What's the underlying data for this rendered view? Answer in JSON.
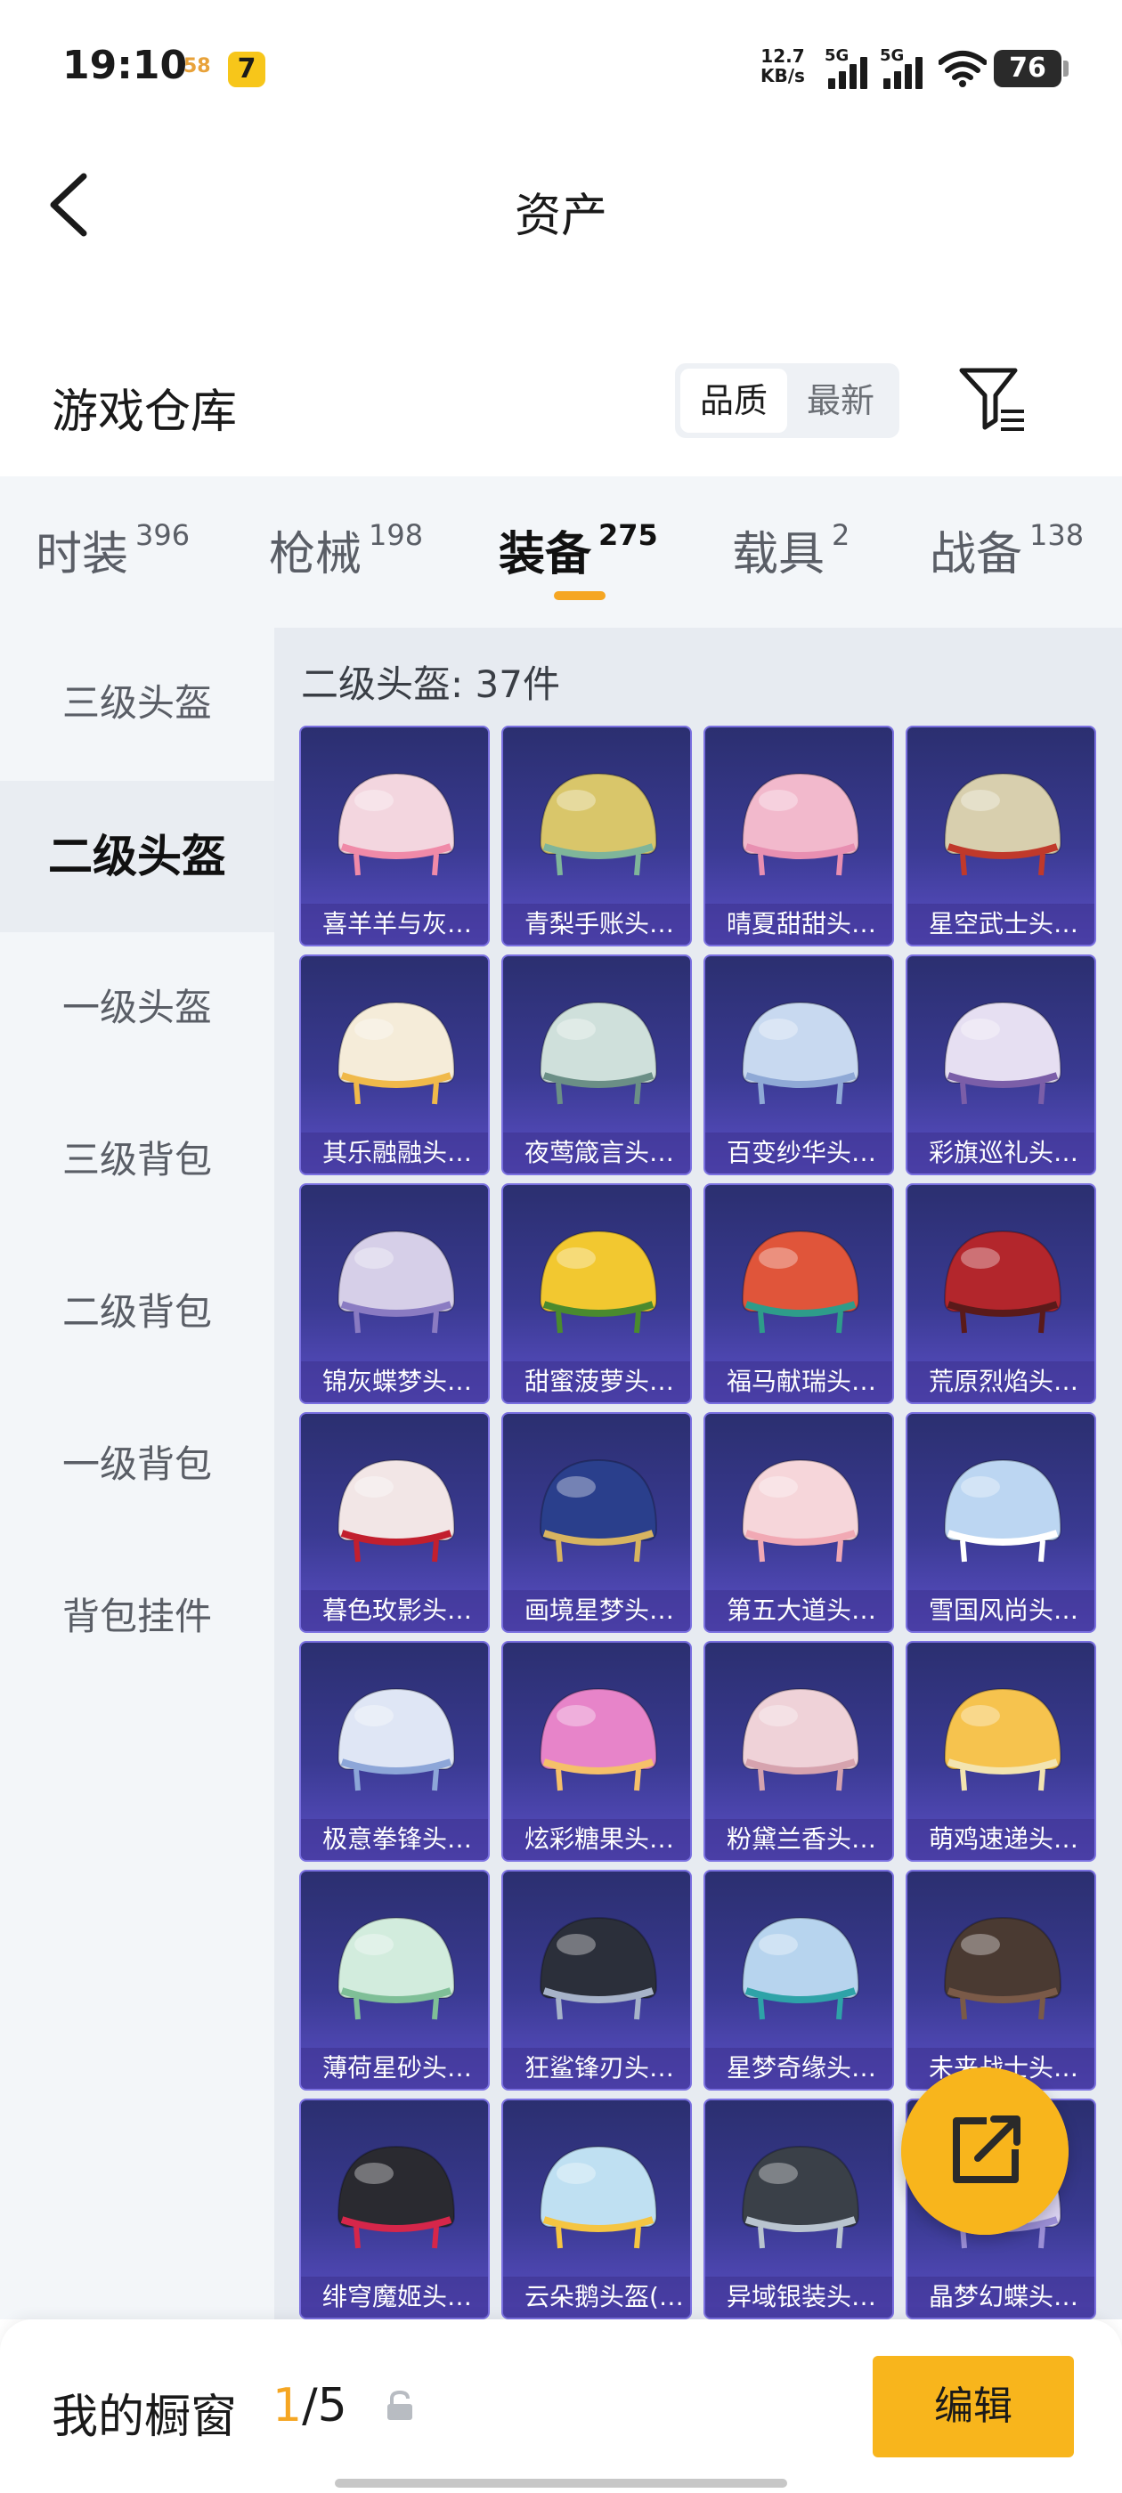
{
  "status_bar": {
    "time": "19:10",
    "app_badge_1": "58",
    "app_badge_2": "7",
    "net_speed_value": "12.7",
    "net_speed_unit": "KB/s",
    "signal_1_label": "5G",
    "signal_2_label": "5G",
    "battery": "76"
  },
  "header": {
    "title": "资产"
  },
  "section": {
    "title": "游戏仓库",
    "sort_options": [
      "品质",
      "最新"
    ],
    "active_sort": "品质"
  },
  "tabs": [
    {
      "label": "时装",
      "count": "396"
    },
    {
      "label": "枪械",
      "count": "198"
    },
    {
      "label": "装备",
      "count": "275"
    },
    {
      "label": "载具",
      "count": "2"
    },
    {
      "label": "战备",
      "count": "138"
    }
  ],
  "active_tab": "装备",
  "side_nav": [
    {
      "label": "三级头盔"
    },
    {
      "label": "二级头盔"
    },
    {
      "label": "一级头盔"
    },
    {
      "label": "三级背包"
    },
    {
      "label": "二级背包"
    },
    {
      "label": "一级背包"
    },
    {
      "label": "背包挂件"
    }
  ],
  "active_side_item": "二级头盔",
  "content": {
    "heading": "二级头盔: 37件",
    "items": [
      {
        "name": "喜羊羊与灰…",
        "color": "#f3d6df",
        "accent": "#f08aa8"
      },
      {
        "name": "青梨手账头…",
        "color": "#d9c66a",
        "accent": "#7fb59a"
      },
      {
        "name": "晴夏甜甜头…",
        "color": "#f2b9cc",
        "accent": "#e88fb1"
      },
      {
        "name": "星空武士头…",
        "color": "#d8cfae",
        "accent": "#c0392b"
      },
      {
        "name": "其乐融融头…",
        "color": "#f5ecd9",
        "accent": "#f0b94a"
      },
      {
        "name": "夜莺箴言头…",
        "color": "#cfe0db",
        "accent": "#6b8f86"
      },
      {
        "name": "百变纱华头…",
        "color": "#c8d9f0",
        "accent": "#8fa9d6"
      },
      {
        "name": "彩旗巡礼头…",
        "color": "#e6dff2",
        "accent": "#7b5ea8"
      },
      {
        "name": "锦灰蝶梦头…",
        "color": "#d6cfe8",
        "accent": "#8a7bc2"
      },
      {
        "name": "甜蜜菠萝头…",
        "color": "#f2c830",
        "accent": "#4a8a2e"
      },
      {
        "name": "福马献瑞头…",
        "color": "#e0553a",
        "accent": "#2e9c8a"
      },
      {
        "name": "荒原烈焰头…",
        "color": "#b3262c",
        "accent": "#5a1a1a"
      },
      {
        "name": "暮色玫影头…",
        "color": "#f2e6e6",
        "accent": "#c21f2e"
      },
      {
        "name": "画境星梦头…",
        "color": "#2a3f8c",
        "accent": "#d8b460"
      },
      {
        "name": "第五大道头…",
        "color": "#f6d6da",
        "accent": "#f1a9b4"
      },
      {
        "name": "雪国风尚头…",
        "color": "#bcd6f2",
        "accent": "#ffffff"
      },
      {
        "name": "极意拳锋头…",
        "color": "#dfe6f5",
        "accent": "#8da6d8"
      },
      {
        "name": "炫彩糖果头…",
        "color": "#e784c9",
        "accent": "#f5c06a"
      },
      {
        "name": "粉黛兰香头…",
        "color": "#efd2d8",
        "accent": "#d6a3ae"
      },
      {
        "name": "萌鸡速递头…",
        "color": "#f6c34e",
        "accent": "#f3e4b0"
      },
      {
        "name": "薄荷星砂头…",
        "color": "#d2ecdd",
        "accent": "#7fbf97"
      },
      {
        "name": "狂鲨锋刃头…",
        "color": "#2b2f3a",
        "accent": "#a7b3c9"
      },
      {
        "name": "星梦奇缘头…",
        "color": "#b7d4ee",
        "accent": "#2ea3a8"
      },
      {
        "name": "未来战士头…",
        "color": "#4a3a32",
        "accent": "#7a5a48"
      },
      {
        "name": "绯穹魔姬头…",
        "color": "#2a2a30",
        "accent": "#d6264a"
      },
      {
        "name": "云朵鹅头盔(…",
        "color": "#bfe0f2",
        "accent": "#f5c542"
      },
      {
        "name": "异域银装头…",
        "color": "#3a4048",
        "accent": "#b9c4cf"
      },
      {
        "name": "晶梦幻蝶头…",
        "color": "#d9d2f0",
        "accent": "#9b8fd6"
      }
    ]
  },
  "footer": {
    "showcase_title": "我的橱窗",
    "showcase_current": "1",
    "showcase_total": "/5",
    "edit_label": "编辑"
  }
}
